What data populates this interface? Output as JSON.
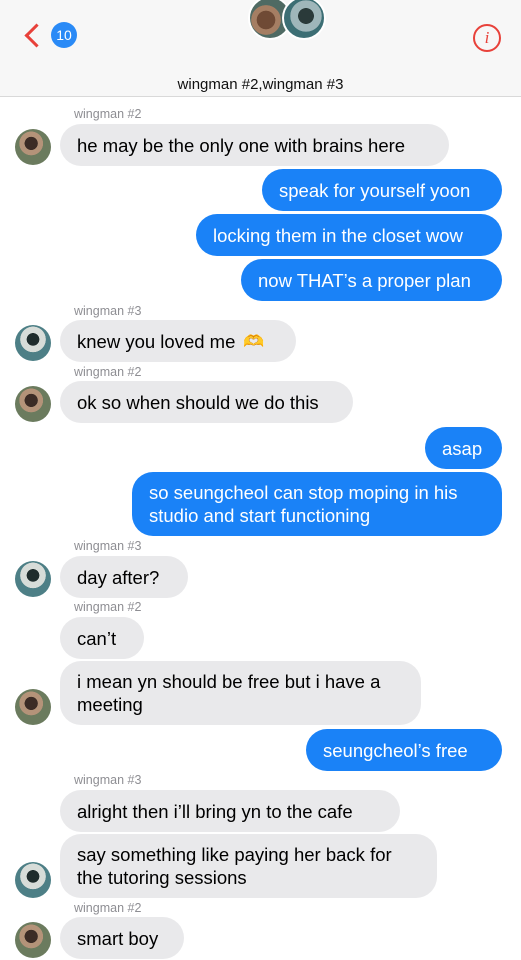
{
  "header": {
    "unread_count": "10",
    "title": "wingman #2,wingman #3"
  },
  "messages": [
    {
      "sender": "wingman #2",
      "text": "he may be the only one with brains here"
    },
    {
      "text": "speak for yourself yoon"
    },
    {
      "text": "locking them in the closet wow"
    },
    {
      "text": "now THAT’s a proper plan"
    },
    {
      "sender": "wingman #3",
      "text": "knew you loved me",
      "emoji": "🫶"
    },
    {
      "sender": "wingman #2",
      "text": "ok so when should we do this"
    },
    {
      "text": "asap"
    },
    {
      "text_line1": "so seungcheol can stop moping in his",
      "text_line2": "studio and start functioning"
    },
    {
      "sender": "wingman #3",
      "text": "day after?"
    },
    {
      "sender": "wingman #2",
      "text": "can’t"
    },
    {
      "text_line1": "i mean yn should be free but i have a",
      "text_line2": "meeting"
    },
    {
      "text": "seungcheol’s free"
    },
    {
      "sender": "wingman #3",
      "text": "alright then i’ll bring yn to the cafe"
    },
    {
      "text_line1": "say something like paying her back for",
      "text_line2": "the tutoring sessions"
    },
    {
      "sender": "wingman #2",
      "text": "smart boy"
    }
  ],
  "colors": {
    "accent": "#e8413a",
    "outgoing": "#1a82f7",
    "incoming": "#e9e9eb",
    "badge": "#2a8af6"
  }
}
